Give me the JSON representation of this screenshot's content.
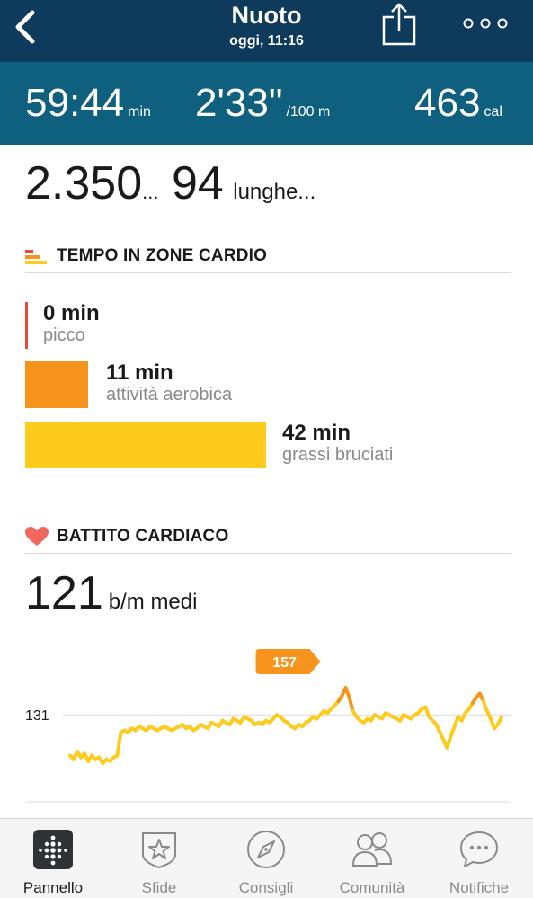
{
  "header": {
    "title": "Nuoto",
    "subtitle": "oggi, 11:16"
  },
  "stats": {
    "duration": {
      "value": "59:44",
      "unit": "min"
    },
    "pace": {
      "value": "2'33\"",
      "unit": "/100 m"
    },
    "calories": {
      "value": "463",
      "unit": "cal"
    }
  },
  "distance": {
    "value": "2.350",
    "ellipsis": "...",
    "laps": "94",
    "laps_label": "lunghe..."
  },
  "cardio_zones": {
    "heading": "TEMPO IN ZONE CARDIO",
    "zones": [
      {
        "value": "0 min",
        "label": "picco",
        "minutes": 0,
        "color": "#e8493a"
      },
      {
        "value": "11 min",
        "label": "attività aerobica",
        "minutes": 11,
        "color": "#f7941d"
      },
      {
        "value": "42 min",
        "label": "grassi bruciati",
        "minutes": 42,
        "color": "#fccb1b"
      }
    ]
  },
  "heart_rate": {
    "heading": "BATTITO CARDIACO",
    "average_value": "121",
    "average_label": "b/m medi",
    "heart_color": "#f0675e"
  },
  "chart_data": {
    "type": "line",
    "title": "",
    "xlabel": "",
    "ylabel": "",
    "reference_line": {
      "value": 131,
      "label": "131"
    },
    "peak_badge": {
      "value": 157,
      "label": "157",
      "color": "#f7941d"
    },
    "ylim": [
      100,
      165
    ],
    "line_colors": {
      "fat_burn": "#fccb1b",
      "cardio": "#f7941d"
    },
    "zone_threshold": 140,
    "series": [
      {
        "x": [
          0,
          1,
          2,
          3,
          4,
          5,
          6,
          7,
          8,
          9,
          10,
          11,
          12,
          13,
          14,
          15,
          16,
          17,
          18,
          19,
          20,
          21,
          22,
          23,
          24,
          25,
          26,
          27,
          28,
          29,
          30,
          31,
          32,
          33,
          34,
          35,
          36,
          37,
          38,
          39,
          40,
          41,
          42,
          43,
          44,
          45,
          46,
          47,
          48,
          49,
          50,
          51,
          52,
          53,
          54,
          55,
          56,
          57,
          58,
          59,
          60,
          61,
          62,
          63,
          64,
          65,
          66,
          67,
          68,
          69,
          70,
          71,
          72,
          73,
          74,
          75,
          76,
          77,
          78,
          79,
          80,
          81,
          82,
          83,
          84,
          85,
          86,
          87,
          88,
          89,
          90,
          91,
          92,
          93,
          94,
          95,
          96,
          97,
          98,
          99,
          100,
          101,
          102,
          103,
          104,
          105,
          106,
          107,
          108,
          109,
          110,
          111,
          112,
          113,
          114,
          115,
          116,
          117,
          118,
          119
        ],
        "values": [
          110,
          108,
          112,
          109,
          111,
          107,
          110,
          108,
          109,
          106,
          108,
          107,
          109,
          110,
          122,
          123,
          122,
          124,
          123,
          125,
          124,
          123,
          125,
          124,
          123,
          124,
          125,
          124,
          123,
          124,
          125,
          126,
          124,
          125,
          123,
          124,
          126,
          125,
          124,
          127,
          126,
          125,
          128,
          127,
          126,
          129,
          128,
          127,
          130,
          129,
          128,
          126,
          127,
          126,
          128,
          127,
          129,
          131,
          130,
          128,
          127,
          125,
          124,
          126,
          125,
          127,
          128,
          130,
          129,
          131,
          133,
          132,
          134,
          136,
          138,
          141,
          145,
          140,
          133,
          130,
          128,
          127,
          129,
          128,
          131,
          130,
          129,
          132,
          131,
          130,
          129,
          128,
          131,
          130,
          129,
          131,
          132,
          134,
          135,
          130,
          128,
          126,
          122,
          118,
          114,
          120,
          125,
          130,
          128,
          132,
          134,
          137,
          140,
          142,
          138,
          133,
          129,
          124,
          126,
          130
        ]
      }
    ]
  },
  "bottom_nav": {
    "items": [
      {
        "label": "Pannello",
        "icon": "dashboard-icon",
        "active": true
      },
      {
        "label": "Sfide",
        "icon": "star-badge-icon",
        "active": false
      },
      {
        "label": "Consigli",
        "icon": "compass-icon",
        "active": false
      },
      {
        "label": "Comunità",
        "icon": "friends-icon",
        "active": false
      },
      {
        "label": "Notifiche",
        "icon": "chat-bubble-icon",
        "active": false
      }
    ]
  }
}
